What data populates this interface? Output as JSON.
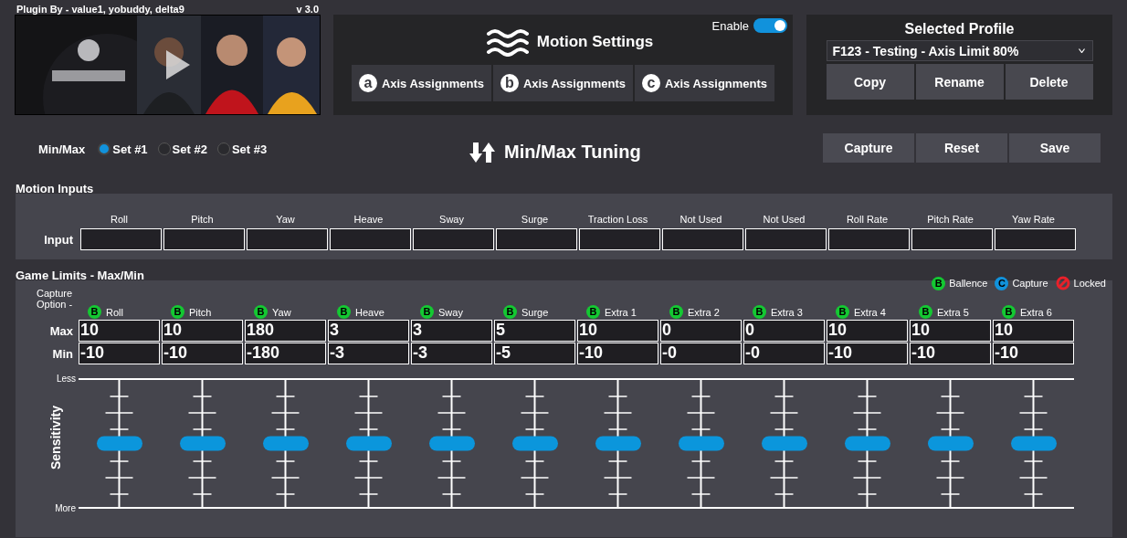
{
  "header": {
    "credits": "Plugin By - value1, yobuddy, delta9",
    "version": "v 3.0"
  },
  "motion_settings": {
    "title": "Motion Settings",
    "enable_label": "Enable",
    "enabled": true,
    "axis_buttons": [
      {
        "badge": "a",
        "label": "Axis Assignments"
      },
      {
        "badge": "b",
        "label": "Axis Assignments"
      },
      {
        "badge": "c",
        "label": "Axis Assignments"
      }
    ]
  },
  "profile": {
    "title": "Selected Profile",
    "selected": "F123 - Testing - Axis Limit 80%",
    "buttons": [
      "Copy",
      "Rename",
      "Delete"
    ]
  },
  "tuning": {
    "label": "Min/Max",
    "sets": [
      {
        "label": "Set #1",
        "selected": true
      },
      {
        "label": "Set #2",
        "selected": false
      },
      {
        "label": "Set #3",
        "selected": false
      }
    ],
    "title": "Min/Max Tuning",
    "buttons": [
      "Capture",
      "Reset",
      "Save"
    ]
  },
  "motion_inputs": {
    "title": "Motion Inputs",
    "row_label": "Input",
    "columns": [
      "Roll",
      "Pitch",
      "Yaw",
      "Heave",
      "Sway",
      "Surge",
      "Traction Loss",
      "Not Used",
      "Not Used",
      "Roll Rate",
      "Pitch Rate",
      "Yaw Rate"
    ]
  },
  "game_limits": {
    "title": "Game Limits - Max/Min",
    "legend": [
      {
        "kind": "balance",
        "symbol": "B",
        "label": "Ballence"
      },
      {
        "kind": "capture",
        "symbol": "C",
        "label": "Capture"
      },
      {
        "kind": "locked",
        "label": "Locked"
      }
    ],
    "capture_label": "Capture Option -",
    "max_label": "Max",
    "min_label": "Min",
    "axis_label": "Sensitivity",
    "less_label": "Less",
    "more_label": "More",
    "columns": [
      {
        "label": "Roll",
        "option": {
          "kind": "balance",
          "symbol": "B"
        },
        "max": "10",
        "min": "-10",
        "level": 0.5
      },
      {
        "label": "Pitch",
        "option": {
          "kind": "balance",
          "symbol": "B"
        },
        "max": "10",
        "min": "-10",
        "level": 0.5
      },
      {
        "label": "Yaw",
        "option": {
          "kind": "balance",
          "symbol": "B"
        },
        "max": "180",
        "min": "-180",
        "level": 0.5
      },
      {
        "label": "Heave",
        "option": {
          "kind": "balance",
          "symbol": "B"
        },
        "max": "3",
        "min": "-3",
        "level": 0.5
      },
      {
        "label": "Sway",
        "option": {
          "kind": "balance",
          "symbol": "B"
        },
        "max": "3",
        "min": "-3",
        "level": 0.5
      },
      {
        "label": "Surge",
        "option": {
          "kind": "balance",
          "symbol": "B"
        },
        "max": "5",
        "min": "-5",
        "level": 0.5
      },
      {
        "label": "Extra 1",
        "option": {
          "kind": "balance",
          "symbol": "B"
        },
        "max": "10",
        "min": "-10",
        "level": 0.5
      },
      {
        "label": "Extra 2",
        "option": {
          "kind": "balance",
          "symbol": "B"
        },
        "max": "0",
        "min": "-0",
        "level": 0.5
      },
      {
        "label": "Extra 3",
        "option": {
          "kind": "balance",
          "symbol": "B"
        },
        "max": "0",
        "min": "-0",
        "level": 0.5
      },
      {
        "label": "Extra 4",
        "option": {
          "kind": "balance",
          "symbol": "B"
        },
        "max": "10",
        "min": "-10",
        "level": 0.5
      },
      {
        "label": "Extra 5",
        "option": {
          "kind": "balance",
          "symbol": "B"
        },
        "max": "10",
        "min": "-10",
        "level": 0.5
      },
      {
        "label": "Extra 6",
        "option": {
          "kind": "balance",
          "symbol": "B"
        },
        "max": "10",
        "min": "-10",
        "level": 0.5
      }
    ]
  }
}
